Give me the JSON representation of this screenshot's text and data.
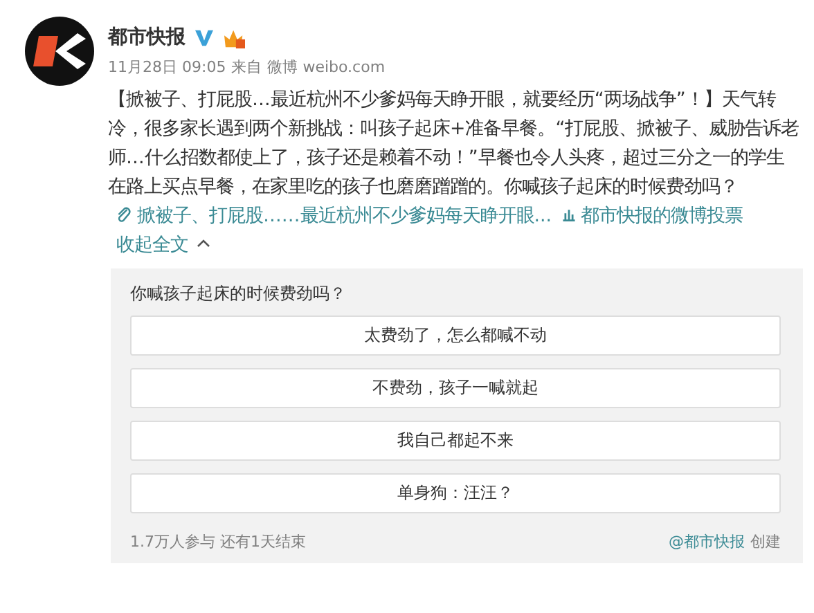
{
  "author": {
    "name": "都市快报"
  },
  "meta": {
    "time": "11月28日 09:05",
    "source_prefix": "来自",
    "source": "微博 weibo.com"
  },
  "post": {
    "text": "【掀被子、打屁股…最近杭州不少爹妈每天睁开眼，就要经历“两场战争”！】天气转冷，很多家长遇到两个新挑战：叫孩子起床+准备早餐。“打屁股、掀被子、威胁告诉老师…什么招数都使上了，孩子还是赖着不动！”早餐也令人头疼，超过三分之一的学生在路上买点早餐，在家里吃的孩子也磨磨蹭蹭的。你喊孩子起床的时候费劲吗？",
    "article_link": "掀被子、打屁股……最近杭州不少爹妈每天睁开眼...",
    "vote_link": "都市快报的微博投票",
    "collapse": "收起全文"
  },
  "poll": {
    "question": "你喊孩子起床的时候费劲吗？",
    "options": [
      "太费劲了，怎么都喊不动",
      "不费劲，孩子一喊就起",
      "我自己都起不来",
      "单身狗：汪汪？"
    ],
    "participants": "1.7万人参与",
    "remaining": "还有1天结束",
    "creator": "@都市快报",
    "creator_suffix": "创建"
  }
}
